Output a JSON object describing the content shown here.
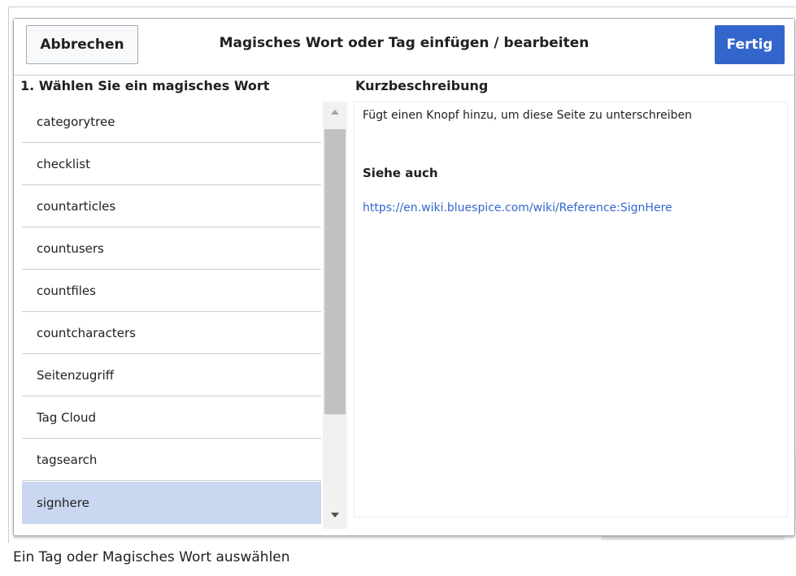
{
  "dialog": {
    "title": "Magisches Wort oder Tag einfügen / bearbeiten",
    "cancel_label": "Abbrechen",
    "done_label": "Fertig"
  },
  "list": {
    "heading": "1. Wählen Sie ein magisches Wort",
    "items": [
      {
        "label": "categorytree"
      },
      {
        "label": "checklist"
      },
      {
        "label": "countarticles"
      },
      {
        "label": "countusers"
      },
      {
        "label": "countfiles"
      },
      {
        "label": "countcharacters"
      },
      {
        "label": "Seitenzugriff"
      },
      {
        "label": "Tag Cloud"
      },
      {
        "label": "tagsearch"
      },
      {
        "label": "signhere"
      }
    ],
    "selected_index": 9
  },
  "description": {
    "heading": "Kurzbeschreibung",
    "text": "Fügt einen Knopf hinzu, um diese Seite zu unterschreiben",
    "see_also_label": "Siehe auch",
    "link": "https://en.wiki.bluespice.com/wiki/Reference:SignHere"
  },
  "caption": "Ein Tag oder Magisches Wort auswählen",
  "colors": {
    "accent": "#3366cc",
    "selected_bg": "#c9d7f0"
  },
  "icons": {
    "scroll_up": "triangle-up-icon",
    "scroll_down": "triangle-down-icon"
  }
}
